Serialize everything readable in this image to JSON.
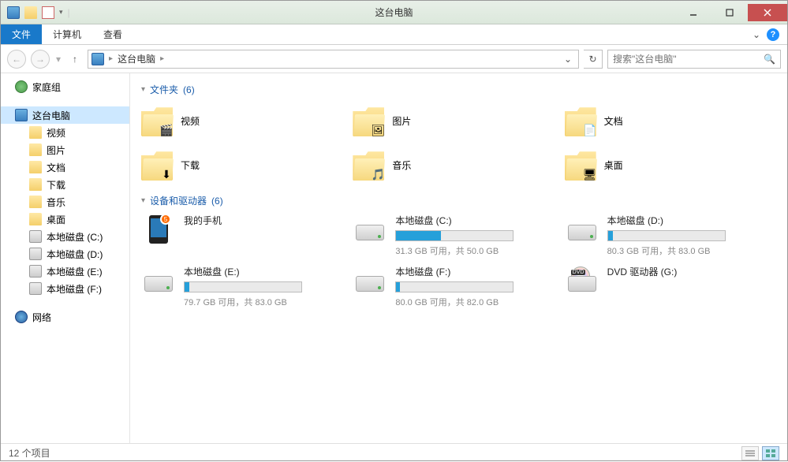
{
  "window": {
    "title": "这台电脑"
  },
  "ribbon": {
    "tabs": [
      {
        "label": "文件",
        "active": true
      },
      {
        "label": "计算机",
        "active": false
      },
      {
        "label": "查看",
        "active": false
      }
    ]
  },
  "address": {
    "crumb": "这台电脑",
    "search_placeholder": "搜索\"这台电脑\""
  },
  "sidebar": {
    "homegroup": "家庭组",
    "this_pc": "这台电脑",
    "children": [
      {
        "label": "视频",
        "icon": "folder"
      },
      {
        "label": "图片",
        "icon": "folder"
      },
      {
        "label": "文档",
        "icon": "folder"
      },
      {
        "label": "下载",
        "icon": "folder"
      },
      {
        "label": "音乐",
        "icon": "folder"
      },
      {
        "label": "桌面",
        "icon": "folder"
      },
      {
        "label": "本地磁盘 (C:)",
        "icon": "drive"
      },
      {
        "label": "本地磁盘 (D:)",
        "icon": "drive"
      },
      {
        "label": "本地磁盘 (E:)",
        "icon": "drive"
      },
      {
        "label": "本地磁盘 (F:)",
        "icon": "drive"
      }
    ],
    "network": "网络"
  },
  "groups": {
    "folders": {
      "title": "文件夹",
      "count": "(6)",
      "items": [
        {
          "label": "视频",
          "badge": "🎬"
        },
        {
          "label": "图片",
          "badge": "🖼"
        },
        {
          "label": "文档",
          "badge": "📄"
        },
        {
          "label": "下载",
          "badge": "⬇"
        },
        {
          "label": "音乐",
          "badge": "🎵"
        },
        {
          "label": "桌面",
          "badge": "🖥"
        }
      ]
    },
    "devices": {
      "title": "设备和驱动器",
      "count": "(6)",
      "items": [
        {
          "type": "phone",
          "label": "我的手机",
          "badge": "5"
        },
        {
          "type": "drive",
          "label": "本地磁盘 (C:)",
          "stats": "31.3 GB 可用，共 50.0 GB",
          "fill": 38
        },
        {
          "type": "drive",
          "label": "本地磁盘 (D:)",
          "stats": "80.3 GB 可用，共 83.0 GB",
          "fill": 4
        },
        {
          "type": "drive",
          "label": "本地磁盘 (E:)",
          "stats": "79.7 GB 可用，共 83.0 GB",
          "fill": 4
        },
        {
          "type": "drive",
          "label": "本地磁盘 (F:)",
          "stats": "80.0 GB 可用，共 82.0 GB",
          "fill": 3
        },
        {
          "type": "dvd",
          "label": "DVD 驱动器 (G:)"
        }
      ]
    }
  },
  "statusbar": {
    "text": "12 个项目"
  }
}
